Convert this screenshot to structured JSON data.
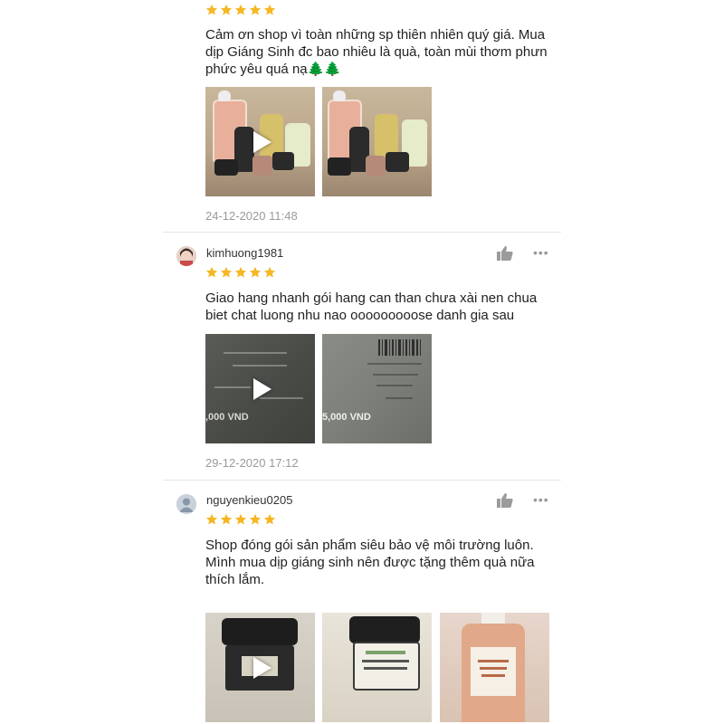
{
  "colors": {
    "star": "#f5b723",
    "date": "#9a9a9a",
    "divider": "#e6e6e6"
  },
  "icons": {
    "rating": "star-icon",
    "like": "thumbs-up-icon",
    "more": "more-options-icon",
    "video": "play-icon"
  },
  "reviews": [
    {
      "username": "",
      "rating": 5,
      "comment": "Cảm ơn shop vì toàn những sp thiên nhiên quý giá. Mua dịp Giáng Sinh đc bao nhiêu là quà, toàn mùi thơm phưn phức yêu quá nạ🌲🌲",
      "date": "24-12-2020 11:48"
    },
    {
      "username": "kimhuong1981",
      "rating": 5,
      "comment": "Giao hang nhanh gói hang can than chưa xài nen chua biet chat luong nhu nao ooooooooose danh gia sau",
      "date": "29-12-2020 17:12",
      "media_text": [
        ",000 VND",
        "5,000 VND"
      ]
    },
    {
      "username": "nguyenkieu0205",
      "rating": 5,
      "comment": "Shop đóng gói sản phẩm siêu bảo vệ môi trường luôn. Mình mua dịp giáng sinh nên được tặng thêm quà nữa thích lắm."
    }
  ]
}
